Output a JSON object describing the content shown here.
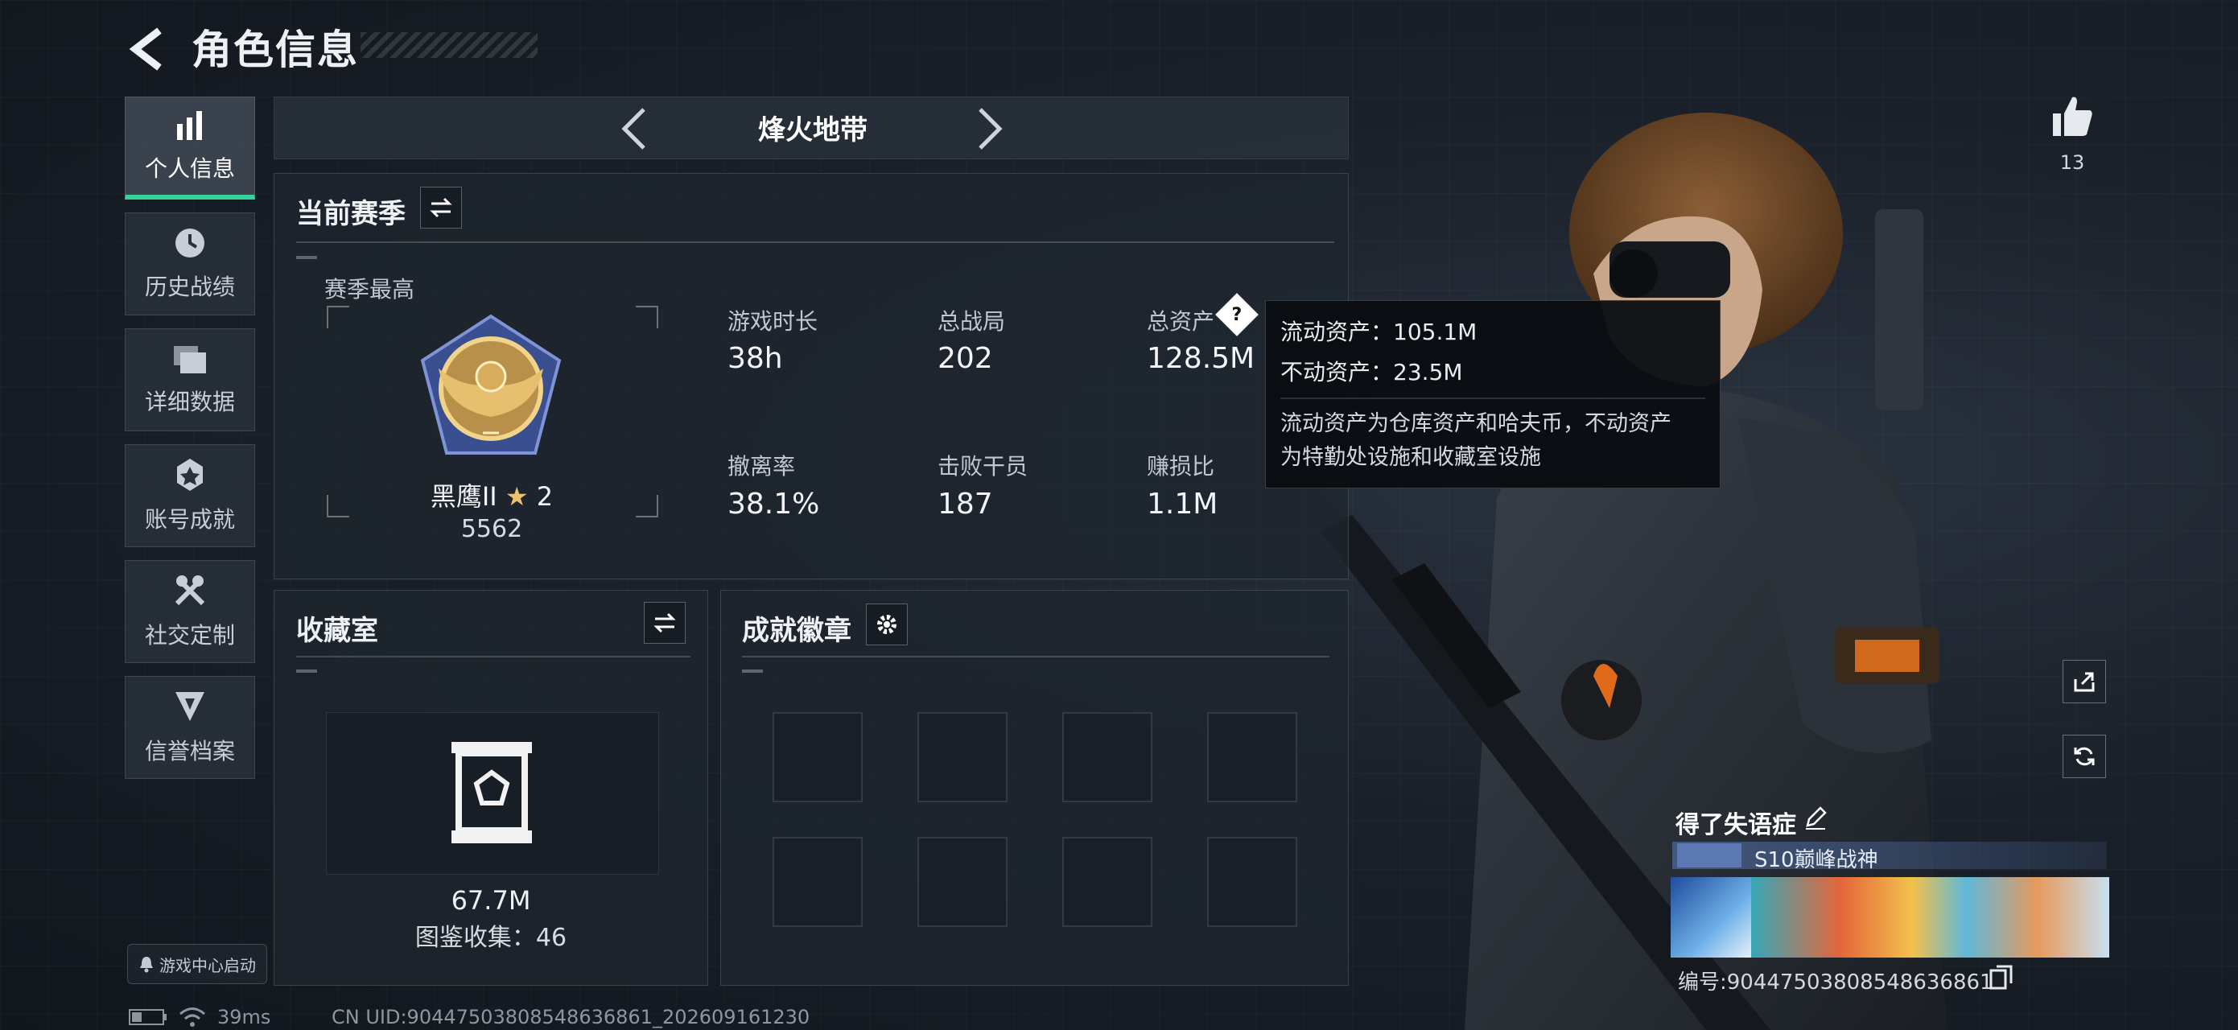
{
  "header": {
    "title": "角色信息"
  },
  "sidebar": {
    "items": [
      {
        "label": "个人信息",
        "icon": "bar-chart-icon"
      },
      {
        "label": "历史战绩",
        "icon": "clock-icon"
      },
      {
        "label": "详细数据",
        "icon": "folder-icon"
      },
      {
        "label": "账号成就",
        "icon": "medal-icon"
      },
      {
        "label": "社交定制",
        "icon": "tools-icon"
      },
      {
        "label": "信誉档案",
        "icon": "shield-icon"
      }
    ],
    "game_center": "游戏中心启动"
  },
  "mode": {
    "title": "烽火地带"
  },
  "season": {
    "title": "当前赛季",
    "best_label": "赛季最高",
    "rank_name": "黑鹰II",
    "rank_stars": "2",
    "rank_score": "5562",
    "stats": [
      {
        "label": "游戏时长",
        "value": "38h"
      },
      {
        "label": "总战局",
        "value": "202"
      },
      {
        "label": "总资产",
        "value": "128.5M"
      },
      {
        "label": "撤离率",
        "value": "38.1%"
      },
      {
        "label": "击败干员",
        "value": "187"
      },
      {
        "label": "赚损比",
        "value": "1.1M"
      }
    ]
  },
  "tooltip": {
    "line1": "流动资产：105.1M",
    "line2": "不动资产：23.5M",
    "desc1": "流动资产为仓库资产和哈夫币，不动资产",
    "desc2": "为特勤处设施和收藏室设施"
  },
  "collection": {
    "title": "收藏室",
    "value": "67.7M",
    "count": "图鉴收集：46"
  },
  "achievements": {
    "title": "成就徽章"
  },
  "profile": {
    "likes": "13",
    "name": "得了失语症",
    "honor_title": "S10巅峰战神",
    "uid": "编号:9044750380854863686​1"
  },
  "status": {
    "ping": "39ms",
    "uid_bottom": "CN UID:9044750380854863686​1_202609161230"
  },
  "colors": {
    "accent": "#33d39a",
    "tooltip_bg": "#0a0d11",
    "title_blue": "#5b78b3"
  }
}
